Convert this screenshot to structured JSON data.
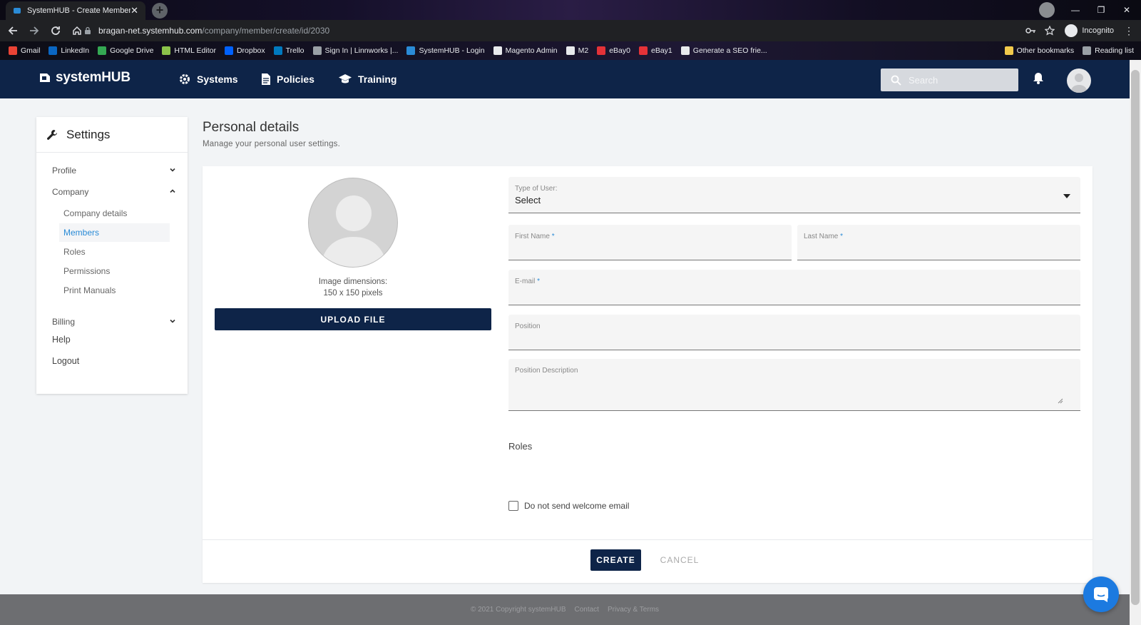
{
  "browser": {
    "tab_title": "SystemHUB - Create Member",
    "url_host": "bragan-net.systemhub.com",
    "url_path": "/company/member/create/id/2030",
    "incognito_label": "Incognito",
    "bookmarks": [
      {
        "label": "Gmail",
        "color": "#ea4335"
      },
      {
        "label": "LinkedIn",
        "color": "#0a66c2"
      },
      {
        "label": "Google Drive",
        "color": "#34a853"
      },
      {
        "label": "HTML Editor",
        "color": "#8bc34a"
      },
      {
        "label": "Dropbox",
        "color": "#0061fe"
      },
      {
        "label": "Trello",
        "color": "#0079bf"
      },
      {
        "label": "Sign In | Linnworks |...",
        "color": "#9aa0a6"
      },
      {
        "label": "SystemHUB - Login",
        "color": "#2a8bd6"
      },
      {
        "label": "Magento Admin",
        "color": "#e8eaed"
      },
      {
        "label": "M2",
        "color": "#e8eaed"
      },
      {
        "label": "eBay0",
        "color": "#e53238"
      },
      {
        "label": "eBay1",
        "color": "#e53238"
      },
      {
        "label": "Generate a SEO frie...",
        "color": "#e8eaed"
      }
    ],
    "other_bookmarks": "Other bookmarks",
    "reading_list": "Reading list"
  },
  "app": {
    "logo": "systemHUB",
    "nav": [
      "Systems",
      "Policies",
      "Training"
    ],
    "search_placeholder": "Search"
  },
  "sidebar": {
    "title": "Settings",
    "items": {
      "profile": "Profile",
      "company": "Company",
      "company_details": "Company details",
      "members": "Members",
      "roles": "Roles",
      "permissions": "Permissions",
      "print_manuals": "Print Manuals",
      "billing": "Billing",
      "help": "Help",
      "logout": "Logout"
    }
  },
  "main": {
    "title": "Personal details",
    "subtitle": "Manage your personal user settings.",
    "image_dims_line1": "Image dimensions:",
    "image_dims_line2": "150 x 150 pixels",
    "upload_label": "UPLOAD FILE",
    "type_of_user_label": "Type of User:",
    "type_of_user_value": "Select",
    "first_name_label": "First Name",
    "last_name_label": "Last Name",
    "email_label": "E-mail",
    "required_mark": "*",
    "position_label": "Position",
    "position_description_label": "Position Description",
    "roles_heading": "Roles",
    "no_welcome_email_label": "Do not send welcome email",
    "create_label": "CREATE",
    "cancel_label": "CANCEL"
  },
  "footer": {
    "copyright": "© 2021 Copyright systemHUB",
    "contact": "Contact",
    "privacy": "Privacy & Terms"
  },
  "colors": {
    "brand_navy": "#0e2448",
    "link_blue": "#2a8bd6",
    "chat_blue": "#1c7ae0"
  }
}
